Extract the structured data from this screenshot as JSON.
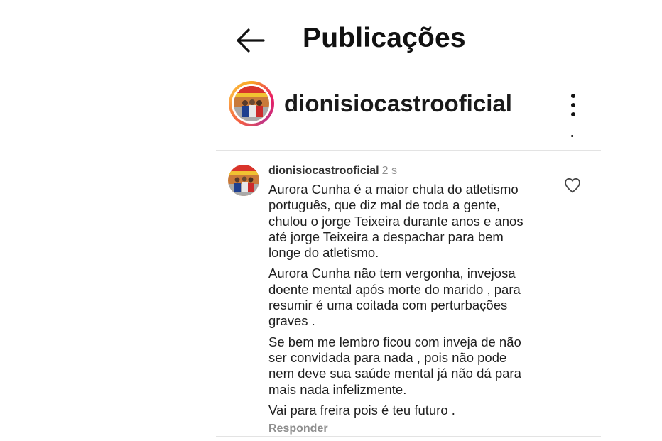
{
  "header": {
    "title": "Publicações",
    "back_icon": "arrow-left-icon"
  },
  "profile": {
    "username": "dionisiocastrooficial",
    "avatar_icon": "profile-photo",
    "story_ring_colors": [
      "#f9a825",
      "#e91e63",
      "#c13584",
      "#f56040",
      "#fcaf45"
    ],
    "more_icon": "vertical-dots-icon"
  },
  "comment": {
    "username": "dionisiocastrooficial",
    "time": "2 s",
    "paragraphs": [
      "Aurora Cunha é a maior chula do atletismo\nportuguês, que diz mal de toda a gente,\nchulou o jorge Teixeira durante anos e anos\naté jorge Teixeira a despachar para bem\nlonge do atletismo.",
      " Aurora Cunha não tem vergonha, invejosa\ndoente mental após morte do marido , para\nresumir é uma coitada com perturbações\ngraves .",
      "Se bem me lembro ficou com inveja de não\nser convidada para nada , pois não pode\nnem deve sua saúde mental já não dá para\nmais nada infelizmente.",
      "Vai para freira pois é teu futuro ."
    ],
    "like_icon": "heart-outline-icon",
    "reply_label": "Responder"
  },
  "colors": {
    "text_primary": "#111111",
    "text_secondary": "#8e8e8e",
    "divider": "#e3e3e3",
    "background": "#ffffff"
  }
}
